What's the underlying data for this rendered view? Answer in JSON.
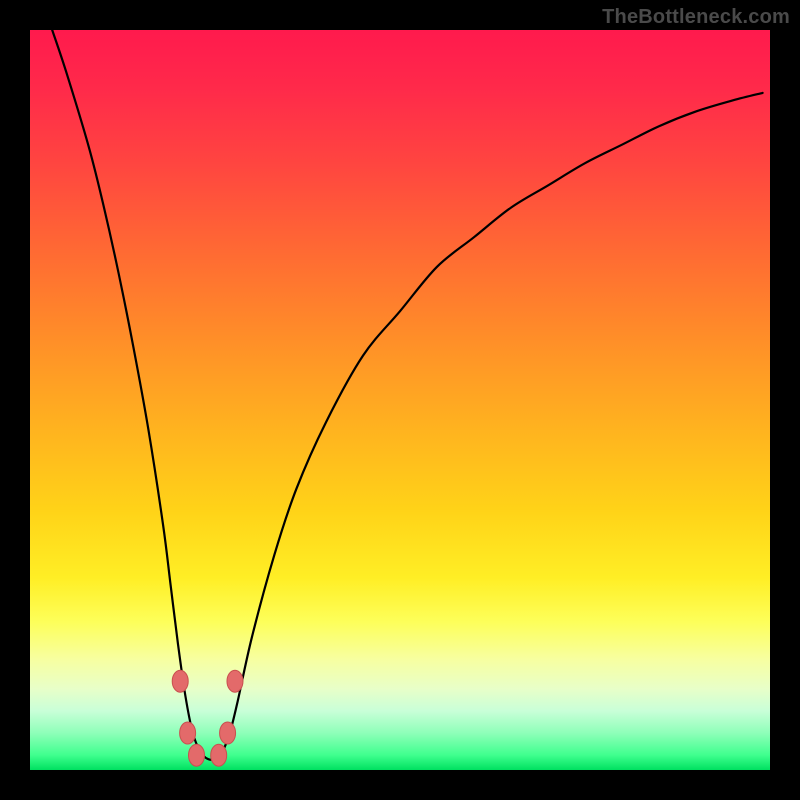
{
  "watermark": "TheBottleneck.com",
  "colors": {
    "frame": "#000000",
    "curve": "#000000",
    "markers_fill": "#e36a6a",
    "markers_stroke": "#c94f4f",
    "gradient_top": "#ff1a4d",
    "gradient_bottom": "#00e060"
  },
  "chart_data": {
    "type": "line",
    "title": "",
    "xlabel": "",
    "ylabel": "",
    "xlim": [
      0,
      100
    ],
    "ylim": [
      0,
      100
    ],
    "grid": false,
    "legend": false,
    "annotations": [],
    "series": [
      {
        "name": "curve",
        "x": [
          3,
          5,
          8,
          10,
          12,
          14,
          16,
          18,
          19,
          20,
          21,
          22,
          23,
          24,
          25,
          26,
          27,
          28,
          30,
          33,
          36,
          40,
          45,
          50,
          55,
          60,
          65,
          70,
          75,
          80,
          85,
          90,
          95,
          99
        ],
        "y": [
          100,
          94,
          84,
          76,
          67,
          57,
          46,
          33,
          25,
          17,
          10,
          5,
          2.5,
          1.5,
          1.5,
          2.5,
          5,
          9,
          18,
          29,
          38,
          47,
          56,
          62,
          68,
          72,
          76,
          79,
          82,
          84.5,
          87,
          89,
          90.5,
          91.5
        ]
      }
    ],
    "markers": [
      {
        "x": 20.3,
        "y": 12.0
      },
      {
        "x": 21.3,
        "y": 5.0
      },
      {
        "x": 22.5,
        "y": 2.0
      },
      {
        "x": 25.5,
        "y": 2.0
      },
      {
        "x": 26.7,
        "y": 5.0
      },
      {
        "x": 27.7,
        "y": 12.0
      }
    ]
  }
}
